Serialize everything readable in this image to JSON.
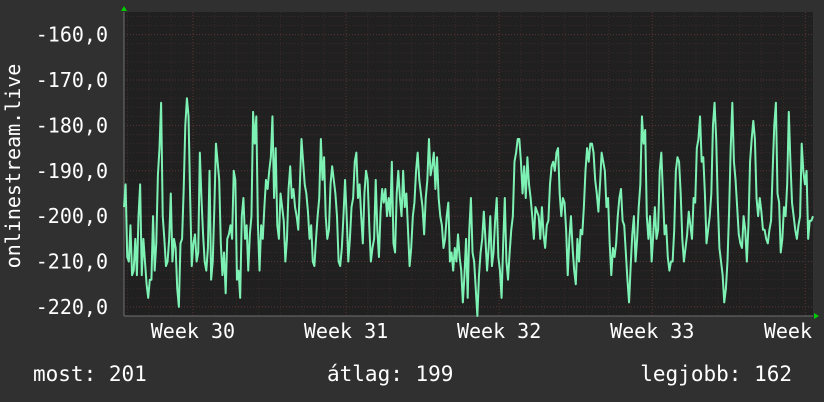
{
  "chart_data": {
    "type": "line",
    "ylabel": "onlinestream.live",
    "ylim": [
      -222,
      -155
    ],
    "yticks": [
      -160,
      -170,
      -180,
      -190,
      -200,
      -210,
      -220
    ],
    "ytick_labels": [
      "-160,0",
      "-170,0",
      "-180,0",
      "-190,0",
      "-200,0",
      "-210,0",
      "-220,0"
    ],
    "xlim": [
      29.55,
      34.05
    ],
    "xticks": [
      30,
      31,
      32,
      33,
      34
    ],
    "xtick_labels": [
      "Week 30",
      "Week 31",
      "Week 32",
      "Week 33",
      "Week"
    ],
    "grid": true,
    "colors": {
      "line": "#7ef2b4",
      "background": "#303030",
      "plot": "#202020",
      "grid": "#5a3535",
      "axis_arrow": "#00cc00"
    },
    "series": [
      {
        "values": [
          -198,
          -193,
          -209,
          -210,
          -202,
          -213,
          -212,
          -205,
          -213,
          -200,
          -193,
          -213,
          -205,
          -210,
          -215,
          -218,
          -214,
          -214,
          -200,
          -212,
          -206,
          -191,
          -185,
          -175,
          -200,
          -205,
          -211,
          -210,
          -205,
          -195,
          -210,
          -205,
          -207,
          -216,
          -220,
          -206,
          -205,
          -194,
          -180,
          -174,
          -178,
          -196,
          -211,
          -206,
          -204,
          -210,
          -208,
          -186,
          -196,
          -204,
          -210,
          -212,
          -207,
          -190,
          -214,
          -210,
          -198,
          -184,
          -188,
          -192,
          -206,
          -213,
          -208,
          -217,
          -205,
          -204,
          -202,
          -205,
          -190,
          -192,
          -214,
          -212,
          -218,
          -200,
          -196,
          -205,
          -202,
          -212,
          -204,
          -200,
          -177,
          -184,
          -178,
          -202,
          -212,
          -202,
          -205,
          -198,
          -192,
          -194,
          -190,
          -187,
          -178,
          -196,
          -185,
          -202,
          -205,
          -195,
          -198,
          -201,
          -210,
          -205,
          -194,
          -189,
          -196,
          -194,
          -198,
          -200,
          -203,
          -193,
          -183,
          -188,
          -193,
          -195,
          -199,
          -205,
          -202,
          -210,
          -211,
          -205,
          -200,
          -196,
          -183,
          -192,
          -187,
          -200,
          -205,
          -203,
          -193,
          -189,
          -192,
          -195,
          -200,
          -210,
          -211,
          -207,
          -200,
          -192,
          -200,
          -210,
          -205,
          -198,
          -196,
          -188,
          -186,
          -196,
          -193,
          -200,
          -206,
          -195,
          -190,
          -192,
          -202,
          -210,
          -207,
          -205,
          -192,
          -203,
          -209,
          -199,
          -194,
          -197,
          -194,
          -200,
          -196,
          -200,
          -188,
          -206,
          -208,
          -195,
          -190,
          -196,
          -200,
          -190,
          -198,
          -195,
          -203,
          -211,
          -207,
          -200,
          -197,
          -190,
          -186,
          -192,
          -195,
          -198,
          -204,
          -196,
          -192,
          -183,
          -191,
          -189,
          -186,
          -194,
          -187,
          -196,
          -200,
          -202,
          -207,
          -205,
          -200,
          -197,
          -210,
          -208,
          -212,
          -207,
          -210,
          -204,
          -209,
          -212,
          -219,
          -213,
          -205,
          -218,
          -203,
          -196,
          -208,
          -210,
          -216,
          -222,
          -213,
          -208,
          -205,
          -199,
          -205,
          -212,
          -207,
          -200,
          -211,
          -208,
          -201,
          -196,
          -209,
          -212,
          -218,
          -206,
          -196,
          -210,
          -214,
          -208,
          -203,
          -200,
          -188,
          -186,
          -183,
          -183,
          -188,
          -195,
          -189,
          -196,
          -187,
          -193,
          -196,
          -200,
          -205,
          -198,
          -199,
          -200,
          -205,
          -198,
          -204,
          -207,
          -202,
          -201,
          -193,
          -189,
          -188,
          -190,
          -186,
          -185,
          -195,
          -200,
          -196,
          -197,
          -203,
          -213,
          -205,
          -200,
          -207,
          -212,
          -215,
          -205,
          -210,
          -203,
          -204,
          -198,
          -190,
          -185,
          -188,
          -184,
          -184,
          -186,
          -192,
          -195,
          -199,
          -193,
          -186,
          -188,
          -190,
          -198,
          -196,
          -206,
          -213,
          -207,
          -209,
          -206,
          -200,
          -196,
          -194,
          -201,
          -202,
          -208,
          -214,
          -219,
          -211,
          -204,
          -200,
          -210,
          -205,
          -198,
          -193,
          -178,
          -184,
          -181,
          -200,
          -205,
          -200,
          -210,
          -204,
          -198,
          -205,
          -203,
          -190,
          -186,
          -195,
          -204,
          -202,
          -209,
          -212,
          -210,
          -210,
          -203,
          -190,
          -187,
          -188,
          -195,
          -205,
          -210,
          -207,
          -204,
          -199,
          -202,
          -205,
          -196,
          -197,
          -185,
          -183,
          -178,
          -188,
          -187,
          -195,
          -206,
          -203,
          -200,
          -195,
          -180,
          -175,
          -183,
          -197,
          -207,
          -210,
          -213,
          -219,
          -216,
          -210,
          -199,
          -185,
          -175,
          -188,
          -192,
          -198,
          -204,
          -206,
          -207,
          -200,
          -203,
          -210,
          -202,
          -188,
          -183,
          -179,
          -183,
          -196,
          -200,
          -196,
          -199,
          -203,
          -203,
          -205,
          -206,
          -203,
          -201,
          -190,
          -180,
          -175,
          -195,
          -197,
          -208,
          -205,
          -198,
          -200,
          -193,
          -177,
          -188,
          -197,
          -200,
          -203,
          -205,
          -202,
          -200,
          -184,
          -190,
          -193,
          -190,
          -205,
          -201,
          -201,
          -200
        ],
        "smoothed": [
          -200.5,
          -199.6,
          -199.1,
          -200.0,
          -200.6,
          -201.3,
          -202.4,
          -203.8,
          -205.9,
          -205.2,
          -201.3,
          -199.5,
          -197.6,
          -198.0,
          -200.3,
          -205.0,
          -207.2,
          -205.0,
          -201.1,
          -198.3,
          -199.4,
          -199.9,
          -196.4,
          -193.0,
          -194.9,
          -197.3,
          -198.6,
          -199.7,
          -200.4,
          -199.3,
          -201.0,
          -201.8,
          -205.2,
          -208.6,
          -210.4,
          -208.6,
          -204.2,
          -199.3,
          -193.0,
          -189.5,
          -192.2,
          -196.8,
          -201.4,
          -200.6,
          -201.1,
          -202.8,
          -203.3,
          -199.1,
          -199.2,
          -200.0,
          -204.5,
          -203.9,
          -200.5,
          -197.6,
          -200.2,
          -201.3,
          -199.3,
          -195.7,
          -195.9,
          -197.8,
          -199.2,
          -201.7,
          -203.2,
          -203.6,
          -201.5,
          -200.5,
          -201.1,
          -201.9,
          -199.8,
          -200.5,
          -202.6,
          -203.1,
          -203.7,
          -201.5,
          -199.8,
          -198.7,
          -198.5,
          -201.1,
          -202.3,
          -201.7,
          -195.9,
          -193.2,
          -192.2,
          -196.1,
          -200.4,
          -201.5,
          -201.2,
          -198.4,
          -196.5,
          -194.3,
          -193.0,
          -191.0,
          -189.2,
          -190.4,
          -191.9,
          -196.3,
          -200.1,
          -199.6,
          -198.6,
          -198.7,
          -200.8,
          -200.6,
          -199.1,
          -198.6,
          -198.3,
          -196.3,
          -197.1,
          -198.7,
          -200.3,
          -198.6,
          -196.0,
          -193.6,
          -191.1,
          -193.0,
          -197.3,
          -200.7,
          -201.1,
          -202.1,
          -204.8,
          -205.5,
          -203.8,
          -200.5,
          -194.9,
          -193.7,
          -193.3,
          -194.2,
          -196.4,
          -197.5,
          -197.1,
          -195.3,
          -194.5,
          -194.3,
          -197.6,
          -202.1,
          -204.1,
          -205.1,
          -203.8,
          -201.3,
          -200.8,
          -202.2,
          -202.6,
          -201.3,
          -198.4,
          -193.4,
          -191.7,
          -193.2,
          -195.6,
          -198.0,
          -198.2,
          -197.7,
          -195.8,
          -196.8,
          -199.4,
          -201.2,
          -201.6,
          -201.8,
          -200.5,
          -200.1,
          -199.5,
          -198.2,
          -196.1,
          -196.0,
          -195.3,
          -196.5,
          -196.3,
          -198.7,
          -200.1,
          -199.2,
          -198.7,
          -196.5,
          -196.4,
          -195.4,
          -195.8,
          -198.2,
          -201.5,
          -202.7,
          -203.1,
          -200.9,
          -196.1,
          -193.4,
          -191.8,
          -194.5,
          -196.8,
          -199.3,
          -199.5,
          -197.5,
          -194.7,
          -192.7,
          -191.2,
          -191.2,
          -190.6,
          -191.2,
          -193.2,
          -197.1,
          -200.1,
          -202.1,
          -202.6,
          -202.2,
          -203.5,
          -203.6,
          -204.6,
          -206.2,
          -207.5,
          -208.8,
          -209.6,
          -210.0,
          -209.8,
          -209.4,
          -208.5,
          -207.6,
          -204.5,
          -205.2,
          -206.8,
          -209.2,
          -212.8,
          -212.9,
          -212.5,
          -210.3,
          -206.5,
          -204.8,
          -206.1,
          -206.2,
          -206.4,
          -207.5,
          -206.4,
          -205.5,
          -204.1,
          -206.0,
          -208.8,
          -210.8,
          -208.5,
          -205.2,
          -205.2,
          -207.2,
          -206.9,
          -204.6,
          -200.9,
          -195.5,
          -191.9,
          -189.5,
          -188.5,
          -188.7,
          -189.4,
          -190.0,
          -190.9,
          -191.6,
          -193.2,
          -195.3,
          -197.5,
          -199.5,
          -199.6,
          -199.8,
          -200.4,
          -201.3,
          -201.3,
          -202.3,
          -203.1,
          -202.5,
          -199.9,
          -195.7,
          -192.5,
          -190.0,
          -189.7,
          -189.2,
          -189.6,
          -191.2,
          -194.0,
          -195.2,
          -196.9,
          -199.8,
          -203.8,
          -204.6,
          -204.9,
          -206.9,
          -208.2,
          -209.3,
          -208.3,
          -207.1,
          -203.8,
          -201.4,
          -197.7,
          -193.9,
          -191.0,
          -188.0,
          -186.6,
          -186.6,
          -189.0,
          -191.5,
          -193.4,
          -193.1,
          -191.4,
          -190.9,
          -191.7,
          -194.5,
          -198.2,
          -202.6,
          -205.9,
          -206.1,
          -206.2,
          -205.5,
          -203.4,
          -200.6,
          -199.5,
          -199.6,
          -202.3,
          -206.6,
          -211.0,
          -211.5,
          -210.0,
          -208.0,
          -206.2,
          -205.6,
          -203.5,
          -199.4,
          -193.9,
          -189.9,
          -190.4,
          -192.8,
          -197.6,
          -201.8,
          -203.3,
          -205.4,
          -205.0,
          -203.6,
          -202.8,
          -200.8,
          -197.5,
          -194.6,
          -195.3,
          -198.0,
          -203.1,
          -206.3,
          -208.4,
          -208.7,
          -206.0,
          -201.3,
          -196.9,
          -194.2,
          -194.7,
          -198.7,
          -203.1,
          -205.6,
          -205.4,
          -203.0,
          -202.0,
          -201.2,
          -199.9,
          -197.2,
          -193.5,
          -188.9,
          -186.3,
          -184.6,
          -185.2,
          -190.1,
          -194.6,
          -197.9,
          -198.3,
          -195.6,
          -190.6,
          -187.1,
          -188.6,
          -194.1,
          -201.2,
          -206.9,
          -211.7,
          -211.6,
          -208.5,
          -201.8,
          -194.0,
          -189.0,
          -189.7,
          -193.2,
          -198.0,
          -201.4,
          -203.8,
          -204.0,
          -204.6,
          -205.0,
          -202.1,
          -195.4,
          -189.2,
          -186.2,
          -187.4,
          -191.5,
          -196.2,
          -198.8,
          -200.5,
          -201.9,
          -203.5,
          -203.9,
          -203.3,
          -199.8,
          -194.0,
          -187.6,
          -186.7,
          -190.4,
          -196.7,
          -200.8,
          -201.0,
          -197.9,
          -193.4,
          -192.7,
          -195.7,
          -199.5,
          -202.3,
          -203.1,
          -201.9,
          -197.7,
          -193.6,
          -193.5,
          -195.6,
          -199.1,
          -200.9,
          -200.9,
          -200.7
        ]
      }
    ]
  },
  "stats": {
    "current_label": "most:",
    "current_value": "201",
    "average_label": "átlag:",
    "average_value": "199",
    "best_label": "legjobb:",
    "best_value": "162"
  }
}
